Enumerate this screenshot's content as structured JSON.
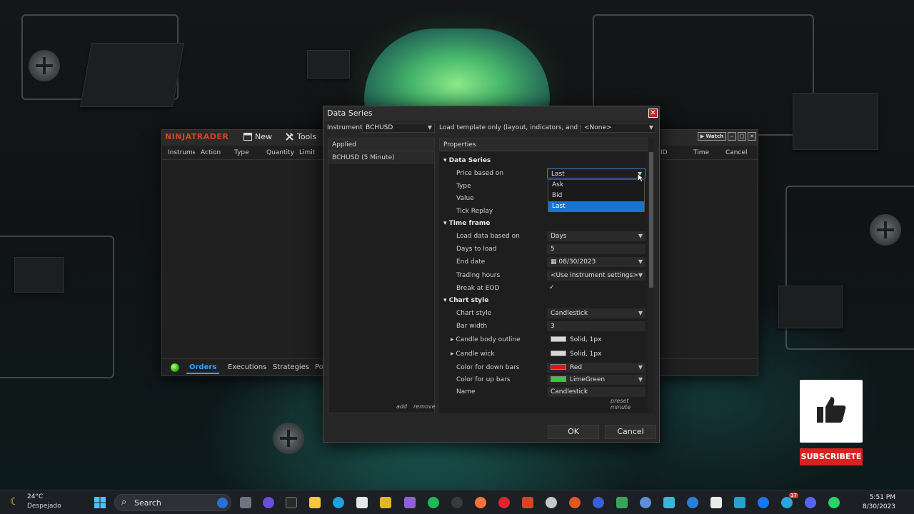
{
  "app": {
    "brand": "NINJATRADER",
    "menu": [
      {
        "label": "New",
        "icon": "new-icon"
      },
      {
        "label": "Tools",
        "icon": "tools-icon"
      }
    ],
    "watch_label": "Watch",
    "columns_left": [
      "Instrument",
      "Action",
      "Type",
      "Quantity",
      "Limit"
    ],
    "columns_right": [
      "ID",
      "Time",
      "Cancel"
    ],
    "tabs": [
      "Orders",
      "Executions",
      "Strategies",
      "Po"
    ],
    "active_tab": "Orders"
  },
  "dialog": {
    "title": "Data Series",
    "instrument_label": "Instrument",
    "instrument_value": "BCHUSD",
    "template_label": "Load template only (layout, indicators, and style)",
    "template_value": "<None>",
    "applied_header": "Applied",
    "applied_items": [
      "BCHUSD (5 Minute)"
    ],
    "add_label": "add",
    "remove_label": "remove",
    "properties_header": "Properties",
    "preset_label": "preset minute",
    "ok_label": "OK",
    "cancel_label": "Cancel",
    "sections": {
      "data_series": {
        "title": "Data Series",
        "price_based_on": {
          "label": "Price based on",
          "value": "Last"
        },
        "type": {
          "label": "Type"
        },
        "value": {
          "label": "Value"
        },
        "tick_replay": {
          "label": "Tick Replay"
        }
      },
      "time_frame": {
        "title": "Time frame",
        "load_data_based_on": {
          "label": "Load data based on",
          "value": "Days"
        },
        "days_to_load": {
          "label": "Days to load",
          "value": "5"
        },
        "end_date": {
          "label": "End date",
          "value": "08/30/2023"
        },
        "trading_hours": {
          "label": "Trading hours",
          "value": "<Use instrument settings>"
        },
        "break_at_eod": {
          "label": "Break at EOD",
          "value": "✓"
        }
      },
      "chart_style": {
        "title": "Chart style",
        "chart_style": {
          "label": "Chart style",
          "value": "Candlestick"
        },
        "bar_width": {
          "label": "Bar width",
          "value": "3"
        },
        "candle_body_outline": {
          "label": "Candle body outline",
          "value": "Solid, 1px",
          "color": "#d9d9d9"
        },
        "candle_wick": {
          "label": "Candle wick",
          "value": "Solid, 1px",
          "color": "#d9d9d9"
        },
        "color_down": {
          "label": "Color for down bars",
          "value": "Red",
          "color": "#e0141a"
        },
        "color_up": {
          "label": "Color for up bars",
          "value": "LimeGreen",
          "color": "#32cd32"
        },
        "name": {
          "label": "Name",
          "value": "Candlestick"
        }
      }
    },
    "dropdown_options": [
      "Ask",
      "Bid",
      "Last"
    ],
    "dropdown_selected": "Last"
  },
  "subscribe_label": "SUBSCRIBETE",
  "taskbar": {
    "temperature": "24°C",
    "weather_desc": "Despejado",
    "search_placeholder": "Search",
    "time": "5:51 PM",
    "date": "8/30/2023",
    "badge_count": "17"
  }
}
